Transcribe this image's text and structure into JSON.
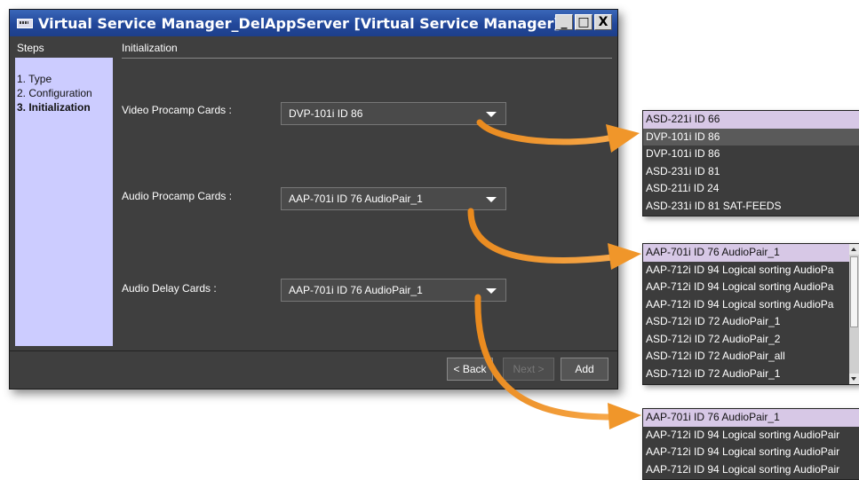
{
  "window": {
    "title": "Virtual Service Manager_DelAppServer [Virtual Service Manager]",
    "controls": {
      "minimize": "_",
      "maximize": "□",
      "close": "X"
    }
  },
  "steps": {
    "header": "Steps",
    "items": [
      {
        "label": "1. Type",
        "active": false
      },
      {
        "label": "2. Configuration",
        "active": false
      },
      {
        "label": "3. Initialization",
        "active": true
      }
    ]
  },
  "main": {
    "header": "Initialization",
    "fields": [
      {
        "label": "Video Procamp Cards :",
        "value": "DVP-101i ID 86"
      },
      {
        "label": "Audio Procamp Cards :",
        "value": "AAP-701i ID 76 AudioPair_1"
      },
      {
        "label": "Audio Delay Cards :",
        "value": "AAP-701i ID 76 AudioPair_1"
      }
    ]
  },
  "buttons": {
    "back": "< Back",
    "next": "Next >",
    "add": "Add"
  },
  "dropdowns": {
    "video": [
      "ASD-221i ID 66",
      "DVP-101i ID 86",
      "DVP-101i ID 86",
      "ASD-231i ID 81",
      "ASD-211i ID 24",
      "ASD-231i ID 81 SAT-FEEDS"
    ],
    "audio_procamp": [
      "AAP-701i ID 76 AudioPair_1",
      "AAP-712i ID 94 Logical sorting AudioPa",
      "AAP-712i ID 94 Logical sorting AudioPa",
      "AAP-712i ID 94 Logical sorting AudioPa",
      "ASD-712i ID 72 AudioPair_1",
      "ASD-712i ID 72 AudioPair_2",
      "ASD-712i ID 72 AudioPair_all",
      "ASD-712i ID 72 AudioPair_1"
    ],
    "audio_delay": [
      "AAP-701i ID 76 AudioPair_1",
      "AAP-712i ID 94 Logical sorting AudioPair",
      "AAP-712i ID 94 Logical sorting AudioPair",
      "AAP-712i ID 94 Logical sorting AudioPair"
    ]
  },
  "colors": {
    "titlebar": "#22479a",
    "steps_panel": "#ccccff",
    "dialog_bg": "#3f3f3f",
    "selected_item": "#d7c8e6",
    "callout_arrow": "#f0962a"
  }
}
